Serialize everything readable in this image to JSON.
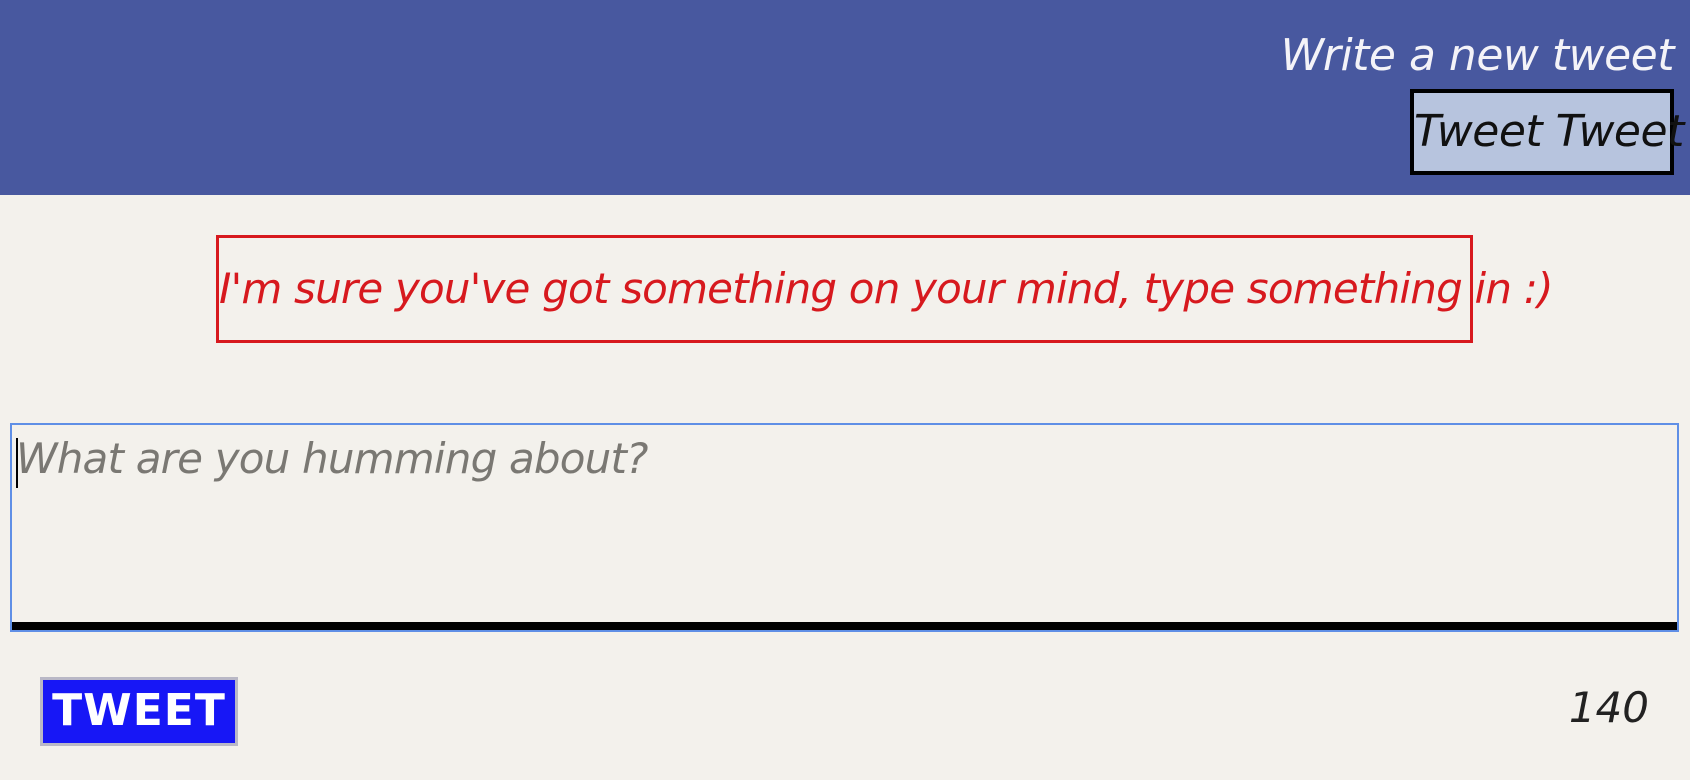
{
  "header": {
    "title": "Write a new tweet",
    "nav_button_label": "Tweet Tweet"
  },
  "error": {
    "message": "I'm sure you've got something on your mind, type something in :)"
  },
  "compose": {
    "value": "",
    "placeholder": "What are you humming about?",
    "submit_label": "TWEET",
    "char_counter": "140"
  },
  "colors": {
    "header_bg": "#48589f",
    "page_bg": "#f3f1ec",
    "error": "#d7191e",
    "submit_bg": "#1717f6",
    "nav_button_bg": "#b7c4de",
    "input_focus_border": "#5f8fe6"
  }
}
